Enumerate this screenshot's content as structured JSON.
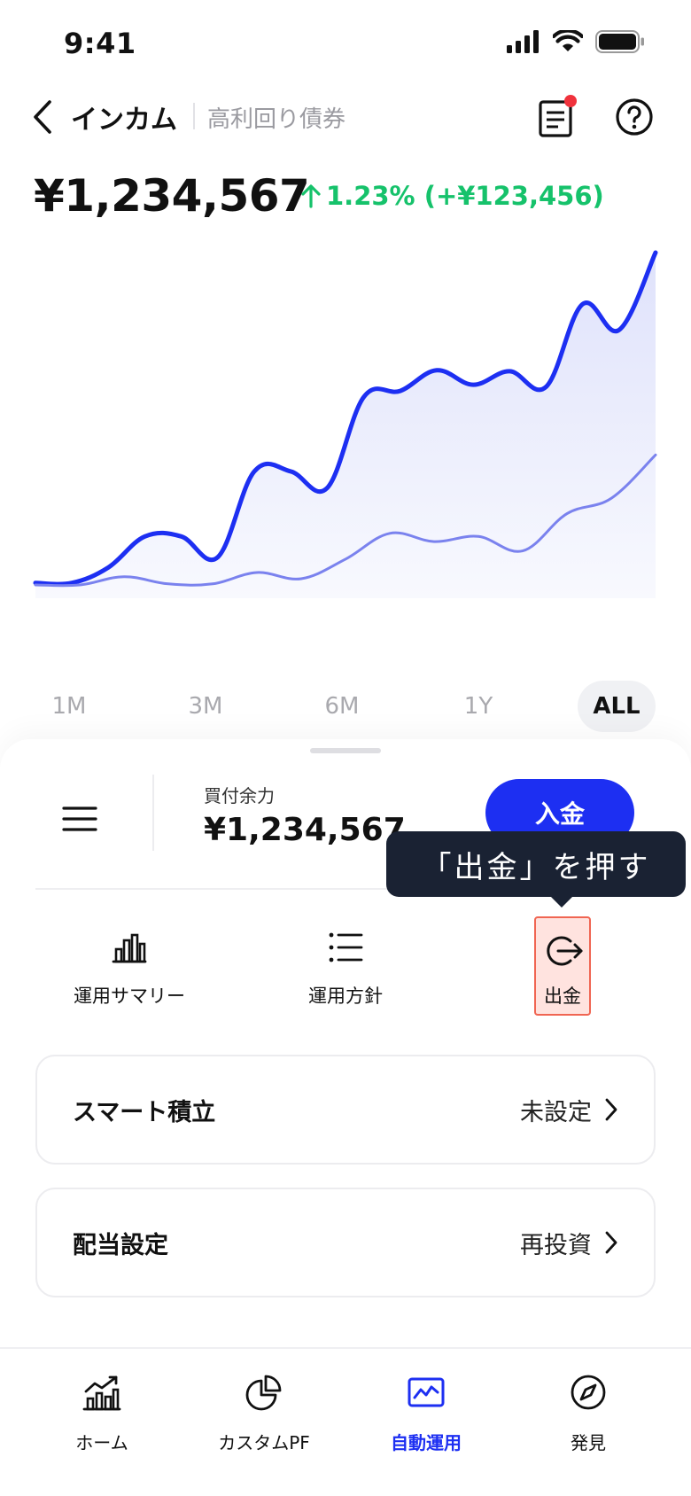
{
  "status_bar": {
    "time": "9:41"
  },
  "header": {
    "title": "インカム",
    "subtitle": "高利回り債券"
  },
  "summary": {
    "total_value": "¥1,234,567",
    "change": "1.23% (+¥123,456)"
  },
  "colors": {
    "accent": "#1d2ff2",
    "positive": "#16c26b",
    "notification": "#f0323c",
    "tooltip_bg": "#1a2233",
    "highlight": "#f06552"
  },
  "chart_data": {
    "type": "area",
    "series": [
      {
        "values": [
          0,
          0,
          1.5,
          4.5,
          4.5,
          2.5,
          10.8,
          10.8,
          9.2,
          18,
          18.6,
          20.6,
          19.2,
          20.5,
          19,
          27,
          24.5,
          32
        ]
      },
      {
        "values": [
          -0.2,
          -0.2,
          0.6,
          -0.1,
          -0.1,
          1,
          0.4,
          2.3,
          4.8,
          4,
          4.5,
          3.1,
          6.7,
          8.2,
          12.4
        ]
      }
    ],
    "range_tabs": [
      "1M",
      "3M",
      "6M",
      "1Y",
      "ALL"
    ],
    "selected_range": "ALL"
  },
  "sheet": {
    "buying_power_label": "買付余力",
    "buying_power_value": "¥1,234,567",
    "deposit_label": "入金",
    "tooltip": "「出金」を押す",
    "actions": [
      {
        "label": "運用サマリー",
        "icon": "bar-chart-icon"
      },
      {
        "label": "運用方針",
        "icon": "list-icon"
      },
      {
        "label": "出金",
        "icon": "withdraw-icon"
      }
    ],
    "cards": [
      {
        "title": "スマート積立",
        "value": "未設定"
      },
      {
        "title": "配当設定",
        "value": "再投資"
      }
    ]
  },
  "tabbar": {
    "items": [
      {
        "label": "ホーム",
        "icon": "home-chart-icon"
      },
      {
        "label": "カスタムPF",
        "icon": "pie-chart-icon"
      },
      {
        "label": "自動運用",
        "icon": "auto-invest-icon"
      },
      {
        "label": "発見",
        "icon": "compass-icon"
      }
    ],
    "active_index": 2
  }
}
